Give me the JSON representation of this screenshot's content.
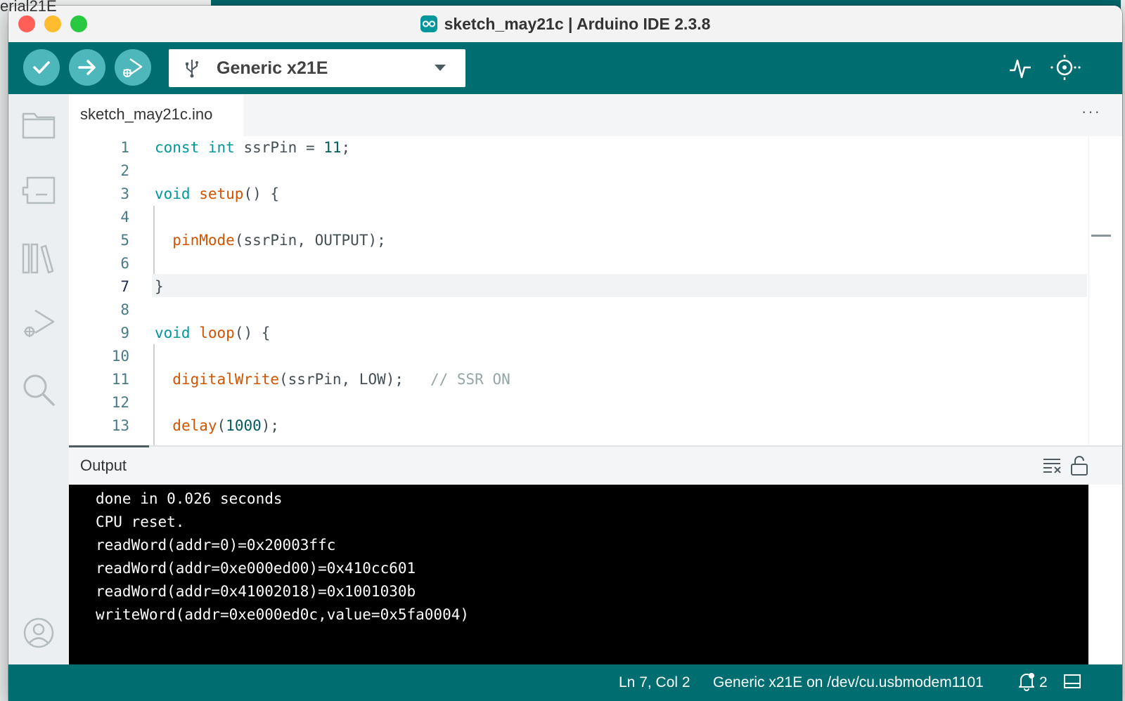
{
  "window": {
    "title": "sketch_may21c | Arduino IDE 2.3.8"
  },
  "background": {
    "fragment": "erial21E"
  },
  "toolbar": {
    "verify_icon": "checkmark-icon",
    "upload_icon": "arrow-right-icon",
    "debug_icon": "debug-play-icon",
    "board": "Generic x21E",
    "plotter_icon": "serial-plotter-icon",
    "monitor_icon": "serial-monitor-icon"
  },
  "sidebar": {
    "items": [
      "sketchbook-icon",
      "boards-manager-icon",
      "library-manager-icon",
      "debug-icon",
      "search-icon",
      "account-icon"
    ]
  },
  "tabs": [
    {
      "label": "sketch_may21c.ino"
    }
  ],
  "tab_more": "···",
  "editor": {
    "current_line": 7,
    "lines": [
      {
        "num": "1"
      },
      {
        "num": "2"
      },
      {
        "num": "3"
      },
      {
        "num": "4"
      },
      {
        "num": "5"
      },
      {
        "num": "6"
      },
      {
        "num": "7"
      },
      {
        "num": "8"
      },
      {
        "num": "9"
      },
      {
        "num": "10"
      },
      {
        "num": "11"
      },
      {
        "num": "12"
      },
      {
        "num": "13"
      }
    ],
    "code": {
      "l1_kw1": "const",
      "l1_kw2": "int",
      "l1_rest": " ssrPin = ",
      "l1_num": "11",
      "l1_end": ";",
      "l3_kw": "void",
      "l3_fn": "setup",
      "l3_rest": "() {",
      "l5_fn": "pinMode",
      "l5_rest": "(ssrPin, OUTPUT);",
      "l7": "}",
      "l9_kw": "void",
      "l9_fn": "loop",
      "l9_rest": "() {",
      "l11_fn": "digitalWrite",
      "l11_rest": "(ssrPin, LOW);   ",
      "l11_cm": "// SSR ON",
      "l13_fn": "delay",
      "l13_p1": "(",
      "l13_num": "1000",
      "l13_p2": ");"
    }
  },
  "output": {
    "title": "Output",
    "lines": [
      "done in 0.026 seconds",
      "CPU reset.",
      "readWord(addr=0)=0x20003ffc",
      "readWord(addr=0xe000ed00)=0x410cc601",
      "readWord(addr=0x41002018)=0x1001030b",
      "writeWord(addr=0xe000ed0c,value=0x5fa0004)"
    ]
  },
  "status": {
    "position": "Ln 7, Col 2",
    "board_port": "Generic x21E on /dev/cu.usbmodem1101",
    "notifications": "2"
  },
  "colors": {
    "teal": "#006d70",
    "button": "#4db7bb",
    "keyword": "#00979d",
    "function": "#d35400"
  }
}
